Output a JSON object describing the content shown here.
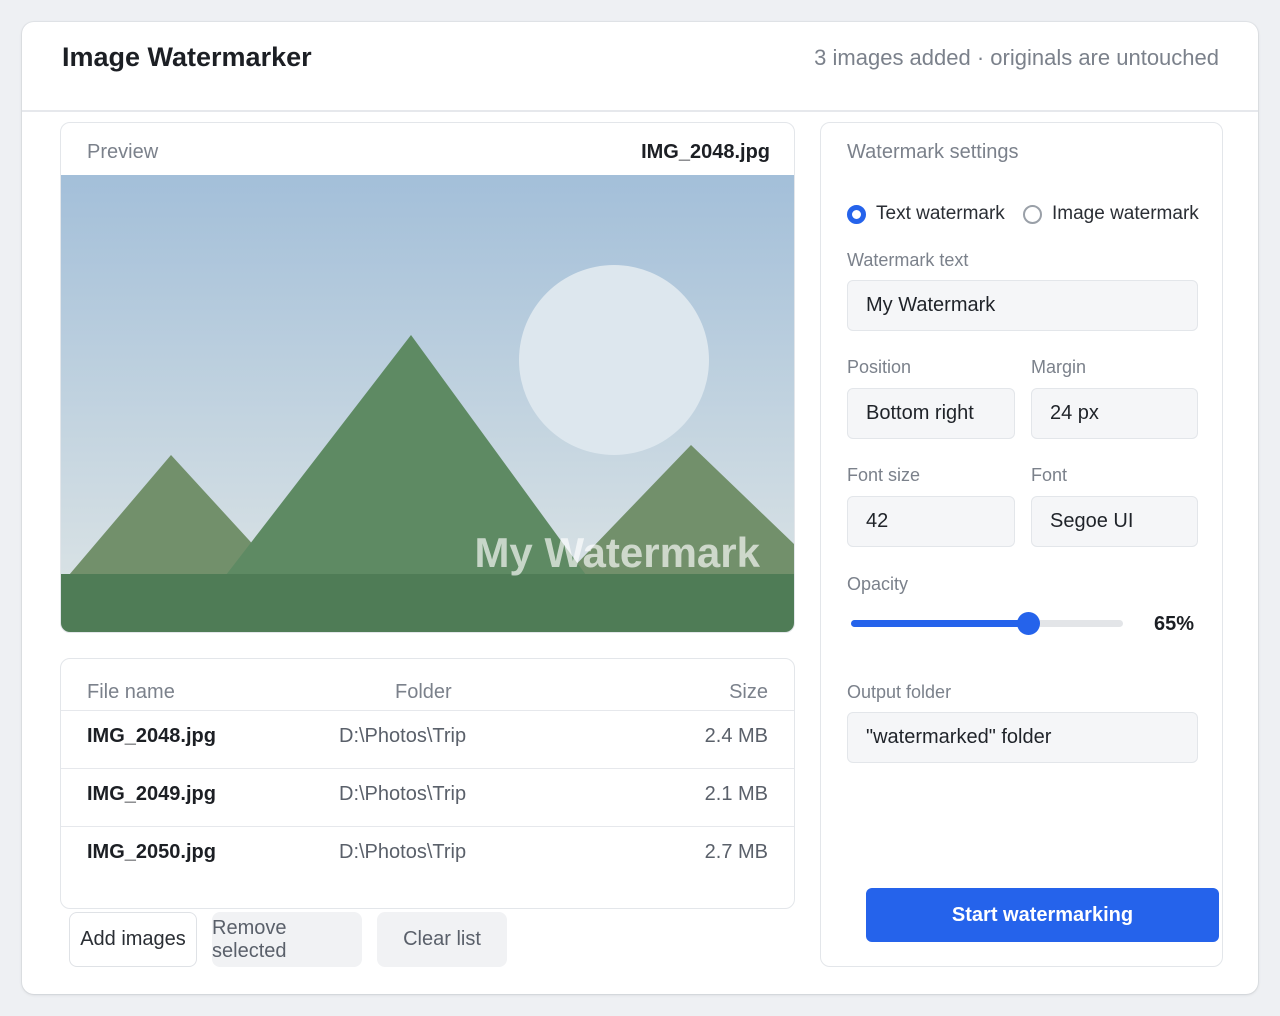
{
  "header": {
    "title": "Image Watermarker",
    "status": "3 images added · originals are untouched"
  },
  "preview": {
    "label": "Preview",
    "filename": "IMG_2048.jpg",
    "watermark_overlay": "My Watermark"
  },
  "files": {
    "columns": {
      "name": "File name",
      "folder": "Folder",
      "size": "Size"
    },
    "rows": [
      {
        "name": "IMG_2048.jpg",
        "folder": "D:\\Photos\\Trip",
        "size": "2.4 MB"
      },
      {
        "name": "IMG_2049.jpg",
        "folder": "D:\\Photos\\Trip",
        "size": "2.1 MB"
      },
      {
        "name": "IMG_2050.jpg",
        "folder": "D:\\Photos\\Trip",
        "size": "2.7 MB"
      }
    ]
  },
  "actions": {
    "add": "Add images",
    "remove": "Remove selected",
    "clear": "Clear list"
  },
  "settings": {
    "title": "Watermark settings",
    "type_options": [
      {
        "label": "Text watermark",
        "selected": true
      },
      {
        "label": "Image watermark",
        "selected": false
      }
    ],
    "text": {
      "label": "Watermark text",
      "value": "My Watermark"
    },
    "position": {
      "label": "Position",
      "value": "Bottom right"
    },
    "margin": {
      "label": "Margin",
      "value": "24 px"
    },
    "font_size": {
      "label": "Font size",
      "value": "42"
    },
    "font": {
      "label": "Font",
      "value": "Segoe UI"
    },
    "opacity": {
      "label": "Opacity",
      "value": 65,
      "display": "65%"
    },
    "output": {
      "label": "Output folder",
      "value": "\"watermarked\" folder"
    },
    "start": "Start watermarking"
  },
  "colors": {
    "accent": "#2563eb",
    "sky_top": "#a3bfd9",
    "sky_bottom": "#dfe6e6",
    "mountain_main": "#5e8a63",
    "mountain_side": "#72906b",
    "ground": "#4f7c56",
    "sun": "#dde7ee"
  },
  "icons": {
    "radio_on": "radio-selected-icon",
    "radio_off": "radio-unselected-icon"
  }
}
